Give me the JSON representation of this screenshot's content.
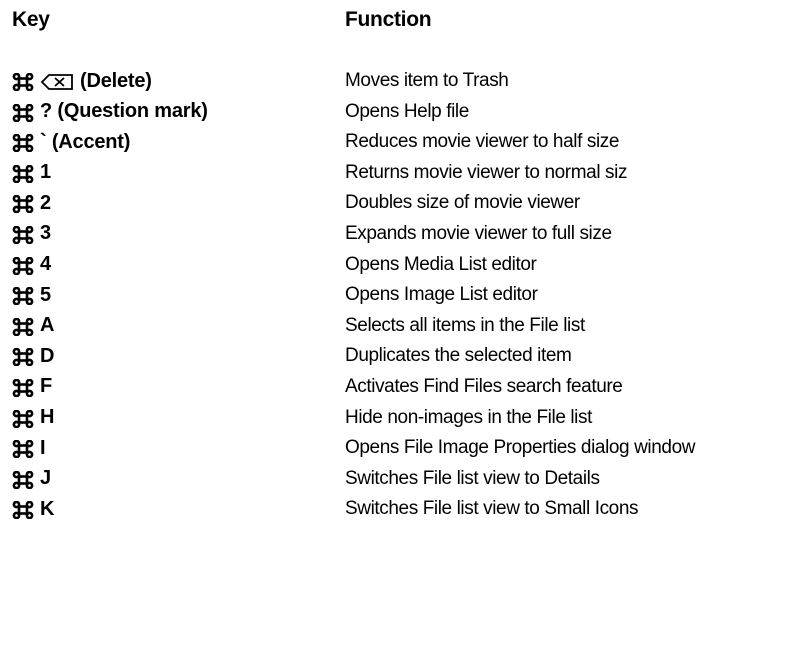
{
  "header": {
    "key_label": "Key",
    "function_label": "Function"
  },
  "rows": [
    {
      "modifier_icon": "command-key-icon",
      "extra_icon": "delete-key-icon",
      "key": "(Delete)",
      "function": "Moves item to Trash"
    },
    {
      "modifier_icon": "command-key-icon",
      "key": "? (Question mark)",
      "function": "Opens Help file"
    },
    {
      "modifier_icon": "command-key-icon",
      "key": "` (Accent)",
      "function": "Reduces movie viewer to half size"
    },
    {
      "modifier_icon": "command-key-icon",
      "key": "1",
      "function": "Returns movie viewer to normal siz"
    },
    {
      "modifier_icon": "command-key-icon",
      "key": "2",
      "function": "Doubles size of movie viewer"
    },
    {
      "modifier_icon": "command-key-icon",
      "key": "3",
      "function": "Expands movie viewer to full size"
    },
    {
      "modifier_icon": "command-key-icon",
      "key": "4",
      "function": "Opens Media List editor"
    },
    {
      "modifier_icon": "command-key-icon",
      "key": "5",
      "function": "Opens Image List editor"
    },
    {
      "modifier_icon": "command-key-icon",
      "key": "A",
      "function": "Selects all items in the File list"
    },
    {
      "modifier_icon": "command-key-icon",
      "key": "D",
      "function": "Duplicates the selected item"
    },
    {
      "modifier_icon": "command-key-icon",
      "key": "F",
      "function": "Activates Find Files search feature"
    },
    {
      "modifier_icon": "command-key-icon",
      "key": "H",
      "function": "Hide non-images in the File list"
    },
    {
      "modifier_icon": "command-key-icon",
      "key": "I",
      "function": "Opens File Image Properties dialog window"
    },
    {
      "modifier_icon": "command-key-icon",
      "key": "J",
      "function": "Switches File list view to Details"
    },
    {
      "modifier_icon": "command-key-icon",
      "key": "K",
      "function": "Switches File list view to Small Icons"
    }
  ]
}
